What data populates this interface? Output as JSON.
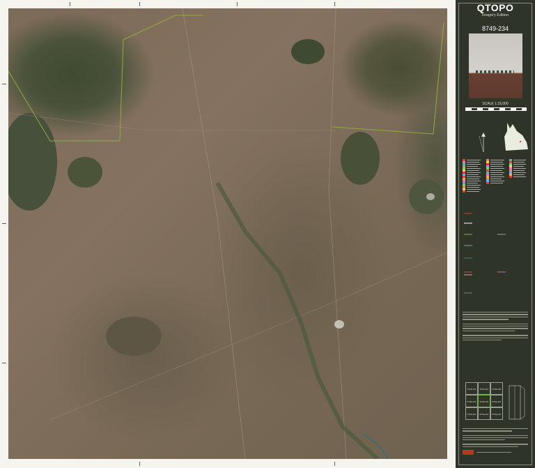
{
  "panel": {
    "title": "QTOPO",
    "subtitle": "Imagery Edition",
    "sheet_number": "8749-234",
    "scale_text": "SCALE 1:15,000",
    "index_cells": [
      "8749-113",
      "8749-114",
      "8749-224",
      "8749-233",
      "8749-234",
      "8749-223",
      "8749-221",
      "8749-232",
      "8749-231"
    ]
  },
  "colors": {
    "panel_bg": "#2f3428",
    "frame_bg": "#f6f4ee",
    "boundary_line": "#8fae3b",
    "creek": "#2e6f7d",
    "index_highlight": "#67b52b"
  }
}
